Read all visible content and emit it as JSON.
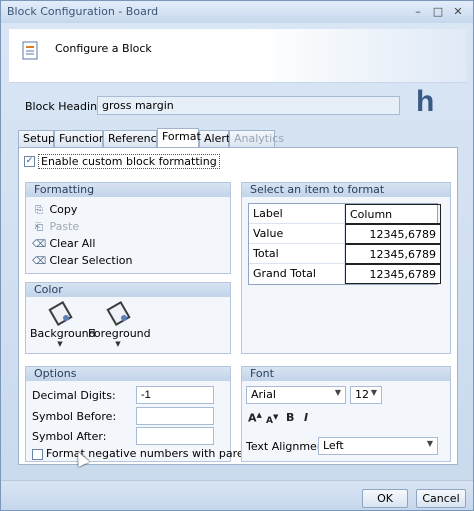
{
  "window": {
    "title": "Block Configuration - Board",
    "minimize_glyph": "–",
    "maximize_glyph": "□",
    "close_glyph": "✕"
  },
  "header": {
    "title": "Configure a Block",
    "icon": "document-settings-icon",
    "logo": "h"
  },
  "block_heading": {
    "label": "Block Heading:",
    "value": "gross margin"
  },
  "tabs": [
    {
      "label": "Setup"
    },
    {
      "label": "Functions"
    },
    {
      "label": "References"
    },
    {
      "label": "Format"
    },
    {
      "label": "Alert"
    },
    {
      "label": "Analytics"
    }
  ],
  "active_tab": "Format",
  "format": {
    "enable_label": "Enable custom block formatting",
    "enable_checked": true,
    "formatting": {
      "title": "Formatting",
      "copy": "Copy",
      "paste": "Paste",
      "clear_all": "Clear All",
      "clear_selection": "Clear Selection"
    },
    "select_item": {
      "title": "Select an item to format",
      "rows": [
        {
          "label": "Label",
          "value": "Column"
        },
        {
          "label": "Value",
          "value": "12345,6789"
        },
        {
          "label": "Total",
          "value": "12345,6789"
        },
        {
          "label": "Grand Total",
          "value": "12345,6789"
        }
      ]
    },
    "color": {
      "title": "Color",
      "background": "Background",
      "foreground": "Foreground"
    },
    "options": {
      "title": "Options",
      "decimal_label": "Decimal Digits:",
      "decimal_value": "-1",
      "symbol_before_label": "Symbol Before:",
      "symbol_before_value": "",
      "symbol_after_label": "Symbol After:",
      "symbol_after_value": "",
      "negative_label": "Format negative numbers with parentheses"
    },
    "font": {
      "title": "Font",
      "family": "Arial",
      "size": "12",
      "grow": "A",
      "shrink": "A",
      "bold": "B",
      "italic": "I",
      "alignment_label": "Text Alignment:",
      "alignment_value": "Left"
    }
  },
  "footer": {
    "ok": "OK",
    "cancel": "Cancel"
  }
}
